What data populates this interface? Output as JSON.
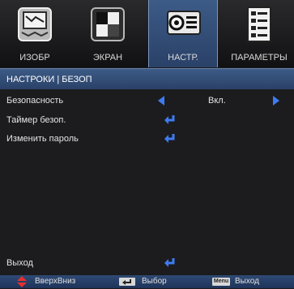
{
  "tabs": [
    {
      "label": "ИЗОБР",
      "icon": "image-settings-icon",
      "active": false
    },
    {
      "label": "ЭКРАН",
      "icon": "screen-icon",
      "active": false
    },
    {
      "label": "НАСТР.",
      "icon": "projector-setup-icon",
      "active": true
    },
    {
      "label": "ПАРАМЕТРЫ",
      "icon": "options-document-icon",
      "active": false
    }
  ],
  "section": {
    "title": "НАСТРОКИ | БЕЗОП"
  },
  "rows": {
    "security": {
      "label": "Безопасность",
      "value": "Вкл."
    },
    "timer": {
      "label": "Таймер безоп."
    },
    "password": {
      "label": "Изменить пароль"
    },
    "exit": {
      "label": "Выход"
    }
  },
  "footer": {
    "updown_label": "ВверхВниз",
    "select_label": "Выбор",
    "menu_key": "Menu",
    "exit_label": "Выход"
  },
  "colors": {
    "accent_blue": "#3c5b86",
    "enter_arrow": "#3e7bf2",
    "updown_red": "#e53030"
  }
}
